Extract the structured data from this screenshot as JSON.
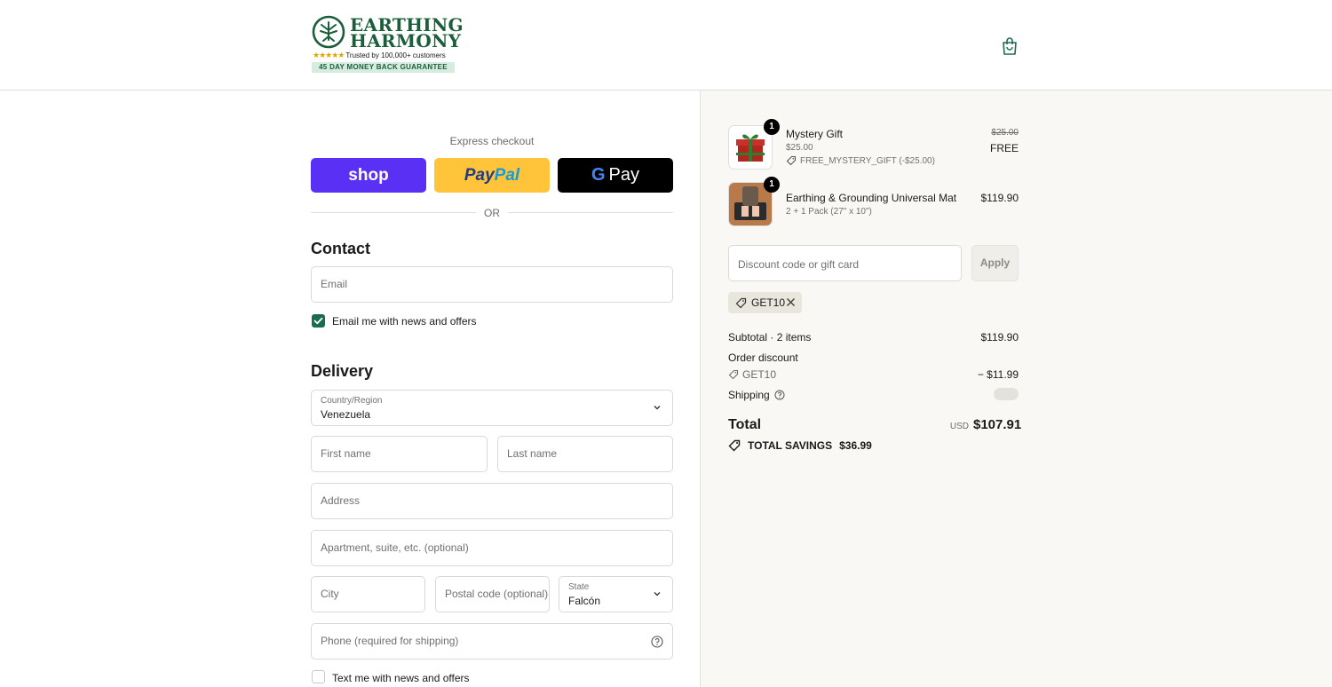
{
  "brand": {
    "name_line1": "EARTHING",
    "name_line2": "HARMONY",
    "stars": "★★★★★",
    "trust_text": "Trusted by 100,000+ customers",
    "guarantee": "45 DAY MONEY BACK GUARANTEE",
    "color": "#1b5e3a"
  },
  "header": {
    "cart_icon": "shopping-bag-icon"
  },
  "express": {
    "label": "Express checkout",
    "shop_label": "shop",
    "paypal_part1": "Pay",
    "paypal_part2": "Pal",
    "gpay_g": "G",
    "gpay_label": "Pay",
    "or_text": "OR",
    "colors": {
      "shop": "#5a31f4",
      "paypal": "#ffc439",
      "gpay": "#000000"
    }
  },
  "contact": {
    "title": "Contact",
    "email_placeholder": "Email",
    "email_value": "",
    "news_label": "Email me with news and offers",
    "news_checked": true
  },
  "delivery": {
    "title": "Delivery",
    "country_label": "Country/Region",
    "country_value": "Venezuela",
    "first_name_placeholder": "First name",
    "last_name_placeholder": "Last name",
    "address_placeholder": "Address",
    "apartment_placeholder": "Apartment, suite, etc. (optional)",
    "city_placeholder": "City",
    "postal_placeholder": "Postal code (optional)",
    "state_label": "State",
    "state_value": "Falcón",
    "phone_placeholder": "Phone (required for shipping)",
    "text_label": "Text me with news and offers",
    "text_checked": false
  },
  "summary": {
    "items": [
      {
        "name": "Mystery Gift",
        "qty": "1",
        "sub_price": "$25.00",
        "discount_code": "FREE_MYSTERY_GIFT (-$25.00)",
        "original_price": "$25.00",
        "price": "FREE",
        "icon": "gift-icon"
      },
      {
        "name": "Earthing & Grounding Universal Mat",
        "qty": "1",
        "variant": "2 + 1 Pack (27\" x 10\")",
        "price": "$119.90",
        "icon": "grounding-mat-image"
      }
    ],
    "discount_placeholder": "Discount code or gift card",
    "apply_label": "Apply",
    "applied_code": "GET10",
    "subtotal_label": "Subtotal · 2 items",
    "subtotal_value": "$119.90",
    "order_discount_label": "Order discount",
    "discount_code_label": "GET10",
    "discount_value": "− $11.99",
    "shipping_label": "Shipping",
    "total_label": "Total",
    "currency": "USD",
    "total_value": "$107.91",
    "savings_label": "TOTAL SAVINGS",
    "savings_value": "$36.99"
  }
}
